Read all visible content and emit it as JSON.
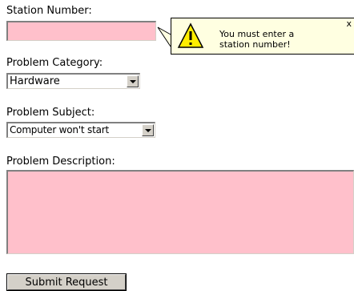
{
  "station": {
    "label": "Station Number:",
    "value": ""
  },
  "tooltip": {
    "message_line1": "You must enter a",
    "message_line2": "station number!",
    "close": "x",
    "icon": "warning-icon"
  },
  "category": {
    "label": "Problem Category:",
    "selected": "Hardware"
  },
  "subject": {
    "label": "Problem Subject:",
    "selected": "Computer won't start"
  },
  "description": {
    "label": "Problem Description:",
    "value": ""
  },
  "submit": {
    "label": "Submit Request"
  },
  "colors": {
    "invalid_field": "#ffc0cb",
    "tooltip_bg": "#ffffe1",
    "warning": "#ffee00"
  }
}
